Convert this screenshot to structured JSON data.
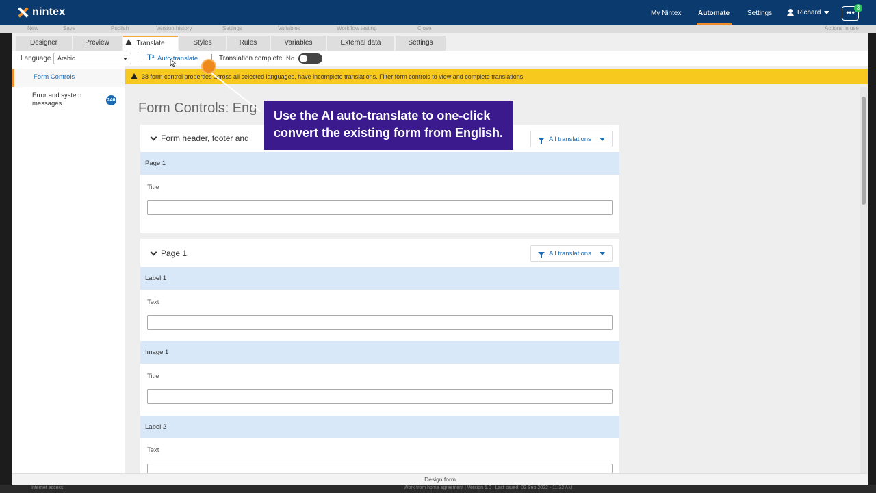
{
  "topnav": {
    "brand": "nintex",
    "links": [
      "My Nintex",
      "Automate",
      "Settings"
    ],
    "active_link": "Automate",
    "user": "Richard",
    "more_label": "•••",
    "notification_count": "3",
    "accent_color": "#f28c28",
    "bg_color": "#0b3a6e"
  },
  "toolbar_faint": {
    "items": [
      "New",
      "Save",
      "Publish",
      "Version history",
      "Settings",
      "Variables",
      "Workflow testing",
      "Close"
    ],
    "right": "Actions in use"
  },
  "tabs": [
    "Designer",
    "Preview",
    "Translate",
    "Styles",
    "Rules",
    "Variables",
    "External data",
    "Settings"
  ],
  "active_tab": "Translate",
  "langbar": {
    "language_label": "Language",
    "language_value": "Arabic",
    "auto_translate_icon": "Tˣ",
    "auto_translate_label": "Auto-translate",
    "translation_complete_label": "Translation complete",
    "translation_complete_value": "No"
  },
  "sidebar": {
    "items": [
      "Form Controls",
      "Error and system messages"
    ],
    "badge": "246"
  },
  "warning": {
    "text": "38 form control properties across all selected languages, have incomplete translations. Filter form controls to view and complete translations.",
    "color": "#f7c81e"
  },
  "main": {
    "heading": "Form Controls: Eng",
    "cards": [
      {
        "title": "Form header, footer and",
        "filter_label": "All translations",
        "sections": [
          {
            "name": "Page 1",
            "field": "Title"
          }
        ]
      },
      {
        "title": "Page 1",
        "filter_label": "All translations",
        "sections": [
          {
            "name": "Label 1",
            "field": "Text"
          },
          {
            "name": "Image 1",
            "field": "Title"
          },
          {
            "name": "Label 2",
            "field": "Text"
          }
        ]
      }
    ]
  },
  "statusbar": {
    "label": "Design form"
  },
  "bottom_faint": {
    "left": "Internet access",
    "right": "Work from home agreement  |  Version 5.0  |  Last saved: 02 Sep 2022 - 11:32 AM"
  },
  "callout": {
    "text_line1": "Use the AI auto-translate to one-click",
    "text_line2": "convert the existing form from English.",
    "bg_color": "#3a1a8c",
    "dot_color": "#ee8a1c"
  }
}
